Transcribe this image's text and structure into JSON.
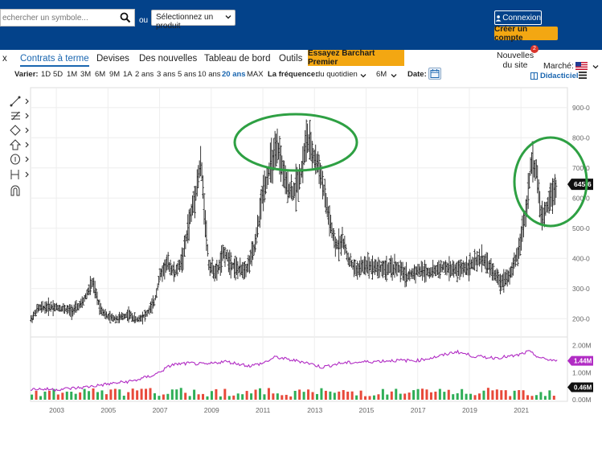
{
  "header": {
    "search_placeholder": "echercher un symbole...",
    "ou_label": "ou",
    "product_select": "Sélectionnez un produit",
    "connexion": "Connexion",
    "create_account": "Créer un compte"
  },
  "nav": {
    "items": [
      "x",
      "Contrats à terme",
      "Devises",
      "Des nouvelles",
      "Tableau de bord",
      "Outils"
    ],
    "premium": "Essayez Barchart Premier",
    "news_line1": "Nouvelles",
    "news_line2": "du site",
    "news_badge": "2",
    "market": "Marché:"
  },
  "toolbar": {
    "varier_label": "Varier:",
    "ranges": [
      "1D",
      "5D",
      "1M",
      "3M",
      "6M",
      "9M",
      "1A",
      "2 ans",
      "3 ans",
      "5 ans",
      "10 ans",
      "20 ans",
      "MAX"
    ],
    "selected_range": "20 ans",
    "frequency_label": "La fréquence:",
    "frequency_value": "du quotidien",
    "period_value": "6M",
    "date_label": "Date:",
    "didacticiel": "Didacticiel"
  },
  "colors": {
    "brand_blue": "#03428a",
    "accent_orange": "#f3a712",
    "highlight_green": "#2ea043",
    "volume_line": "#b12cc4"
  },
  "chart_data": {
    "type": "ohlc-bar",
    "x_ticks": [
      "2003",
      "2005",
      "2007",
      "2009",
      "2011",
      "2013",
      "2015",
      "2017",
      "2019",
      "2021"
    ],
    "price_ticks": [
      "900-0",
      "800-0",
      "700-0",
      "600-0",
      "500-0",
      "400-0",
      "300-0",
      "200-0"
    ],
    "ylim": [
      150,
      950
    ],
    "last_price_label": "645-6",
    "last_price": 645.75,
    "price_series": [
      {
        "x": 2002.0,
        "y": 195
      },
      {
        "x": 2002.3,
        "y": 235
      },
      {
        "x": 2002.8,
        "y": 240
      },
      {
        "x": 2003.2,
        "y": 235
      },
      {
        "x": 2003.6,
        "y": 225
      },
      {
        "x": 2004.0,
        "y": 250
      },
      {
        "x": 2004.4,
        "y": 320
      },
      {
        "x": 2004.7,
        "y": 235
      },
      {
        "x": 2005.0,
        "y": 205
      },
      {
        "x": 2005.4,
        "y": 200
      },
      {
        "x": 2005.8,
        "y": 215
      },
      {
        "x": 2006.1,
        "y": 195
      },
      {
        "x": 2006.5,
        "y": 215
      },
      {
        "x": 2006.8,
        "y": 255
      },
      {
        "x": 2007.0,
        "y": 340
      },
      {
        "x": 2007.3,
        "y": 385
      },
      {
        "x": 2007.6,
        "y": 350
      },
      {
        "x": 2007.9,
        "y": 400
      },
      {
        "x": 2008.1,
        "y": 500
      },
      {
        "x": 2008.4,
        "y": 620
      },
      {
        "x": 2008.6,
        "y": 720
      },
      {
        "x": 2008.9,
        "y": 380
      },
      {
        "x": 2009.2,
        "y": 350
      },
      {
        "x": 2009.5,
        "y": 420
      },
      {
        "x": 2009.8,
        "y": 380
      },
      {
        "x": 2010.1,
        "y": 360
      },
      {
        "x": 2010.4,
        "y": 370
      },
      {
        "x": 2010.7,
        "y": 440
      },
      {
        "x": 2011.0,
        "y": 620
      },
      {
        "x": 2011.3,
        "y": 710
      },
      {
        "x": 2011.6,
        "y": 760
      },
      {
        "x": 2011.9,
        "y": 640
      },
      {
        "x": 2012.2,
        "y": 620
      },
      {
        "x": 2012.5,
        "y": 690
      },
      {
        "x": 2012.7,
        "y": 800
      },
      {
        "x": 2013.0,
        "y": 730
      },
      {
        "x": 2013.2,
        "y": 700
      },
      {
        "x": 2013.5,
        "y": 560
      },
      {
        "x": 2013.8,
        "y": 440
      },
      {
        "x": 2014.1,
        "y": 460
      },
      {
        "x": 2014.3,
        "y": 400
      },
      {
        "x": 2014.6,
        "y": 360
      },
      {
        "x": 2015.0,
        "y": 380
      },
      {
        "x": 2015.4,
        "y": 370
      },
      {
        "x": 2015.8,
        "y": 365
      },
      {
        "x": 2016.2,
        "y": 370
      },
      {
        "x": 2016.6,
        "y": 340
      },
      {
        "x": 2017.0,
        "y": 360
      },
      {
        "x": 2017.5,
        "y": 355
      },
      {
        "x": 2018.0,
        "y": 370
      },
      {
        "x": 2018.5,
        "y": 360
      },
      {
        "x": 2019.0,
        "y": 375
      },
      {
        "x": 2019.5,
        "y": 400
      },
      {
        "x": 2019.8,
        "y": 370
      },
      {
        "x": 2020.2,
        "y": 320
      },
      {
        "x": 2020.6,
        "y": 350
      },
      {
        "x": 2020.9,
        "y": 420
      },
      {
        "x": 2021.2,
        "y": 560
      },
      {
        "x": 2021.4,
        "y": 720
      },
      {
        "x": 2021.6,
        "y": 690
      },
      {
        "x": 2021.8,
        "y": 520
      },
      {
        "x": 2022.1,
        "y": 600
      },
      {
        "x": 2022.4,
        "y": 645
      }
    ],
    "volume_line_series": [
      {
        "x": 2002.0,
        "y": 0.4
      },
      {
        "x": 2003.0,
        "y": 0.38
      },
      {
        "x": 2004.0,
        "y": 0.45
      },
      {
        "x": 2005.0,
        "y": 0.58
      },
      {
        "x": 2006.0,
        "y": 0.7
      },
      {
        "x": 2006.8,
        "y": 0.92
      },
      {
        "x": 2007.5,
        "y": 1.3
      },
      {
        "x": 2008.2,
        "y": 1.35
      },
      {
        "x": 2008.8,
        "y": 1.3
      },
      {
        "x": 2009.5,
        "y": 1.42
      },
      {
        "x": 2010.5,
        "y": 1.25
      },
      {
        "x": 2011.0,
        "y": 1.35
      },
      {
        "x": 2011.5,
        "y": 1.58
      },
      {
        "x": 2012.0,
        "y": 1.48
      },
      {
        "x": 2012.6,
        "y": 1.4
      },
      {
        "x": 2013.3,
        "y": 1.2
      },
      {
        "x": 2014.0,
        "y": 1.35
      },
      {
        "x": 2015.0,
        "y": 1.4
      },
      {
        "x": 2016.0,
        "y": 1.45
      },
      {
        "x": 2017.0,
        "y": 1.45
      },
      {
        "x": 2017.8,
        "y": 1.6
      },
      {
        "x": 2018.5,
        "y": 1.78
      },
      {
        "x": 2019.2,
        "y": 1.6
      },
      {
        "x": 2020.0,
        "y": 1.55
      },
      {
        "x": 2020.8,
        "y": 1.62
      },
      {
        "x": 2021.3,
        "y": 1.78
      },
      {
        "x": 2021.8,
        "y": 1.52
      },
      {
        "x": 2022.4,
        "y": 1.44
      }
    ],
    "volume_ticks": [
      "2.00M",
      "1.00M",
      "0.00M"
    ],
    "volume_last_label": "1.44M",
    "volume_bar_label": "0.46M",
    "volume_ylim": [
      0,
      2.2
    ]
  }
}
